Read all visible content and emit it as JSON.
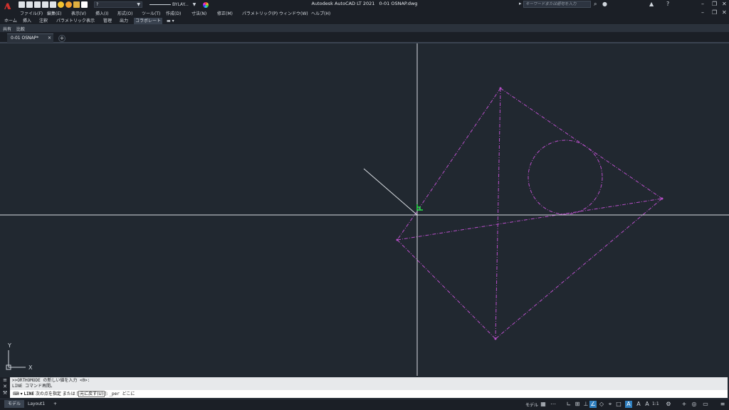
{
  "title_bar": {
    "logo": "A",
    "layer_value": "?",
    "linetype_value": "BYLAY...",
    "app_name": "Autodesk AutoCAD LT 2021",
    "file_name": "0-01 OSNAP.dwg",
    "search_placeholder": "キーワードまたは語句を入力",
    "icons": [
      "new-icon",
      "open-icon",
      "save-icon",
      "saveas-icon",
      "print-icon",
      "lightbulb-icon",
      "sun-icon",
      "lock-icon",
      "layer-color-icon",
      "color-wheel-icon",
      "user-icon",
      "autodesk-app-icon",
      "help-icon"
    ]
  },
  "menu_bar": {
    "items": [
      "ファイル(F)",
      "編集(E)",
      "表示(V)",
      "挿入(I)",
      "形式(O)",
      "ツール(T)",
      "作成(D)",
      "寸法(N)",
      "修正(M)",
      "パラメトリック(P)",
      "ウィンドウ(W)",
      "ヘルプ(H)"
    ]
  },
  "ribbon": {
    "tabs": [
      "ホーム",
      "挿入",
      "注釈",
      "パラメトリック",
      "表示",
      "管理",
      "出力",
      "コラボレート"
    ],
    "active_tab": "コラボレート",
    "panel_items": [
      "共有",
      "比較"
    ]
  },
  "file_tabs": {
    "tabs": [
      {
        "label": "0-01 OSNAP*",
        "close": "✕"
      }
    ],
    "new_tab": "+"
  },
  "drawing": {
    "geometry_color": "#b84fc9",
    "crosshair_color": "#d9dde2",
    "snap_marker_color": "#22dd44",
    "ucs_labels": {
      "x": "X",
      "y": "Y"
    }
  },
  "command_line": {
    "history": [
      ">>ORTHOMODE の新しい値を入力 <0>:",
      "LINE コマンド再開。"
    ],
    "prompt_command": "LINE",
    "prompt_text": "次の点を指定 または",
    "prompt_option": "元に戻す(U)",
    "prompt_tail": "]:",
    "prompt_input": "_per どこに"
  },
  "layout_tabs": {
    "tabs": [
      "モデル",
      "Layout1"
    ],
    "active": "モデル",
    "add": "+"
  },
  "status_bar": {
    "model_label": "モデル",
    "scale": "1:1"
  }
}
